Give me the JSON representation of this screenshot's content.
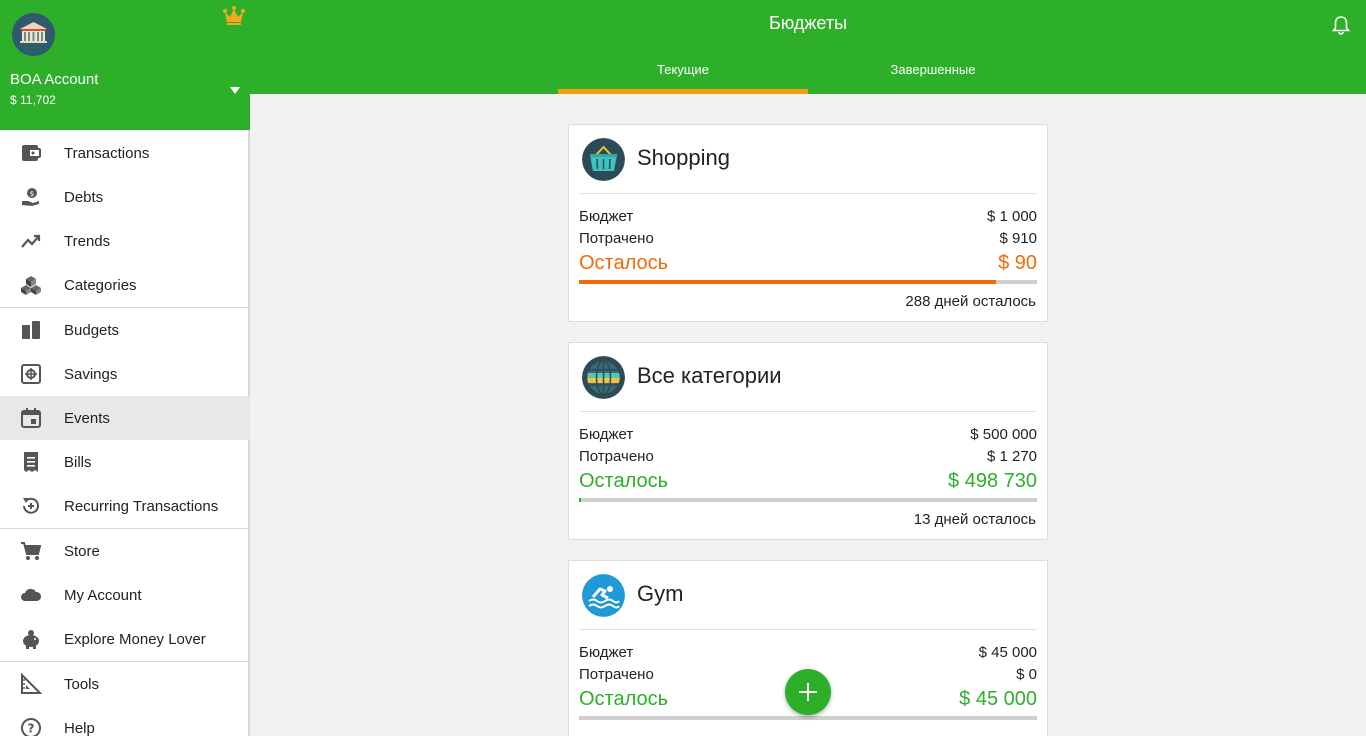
{
  "sidebar": {
    "wallet": {
      "name": "BOA Account",
      "balance": "$ 11,702"
    },
    "items": [
      {
        "label": "Transactions",
        "icon": "wallet-icon"
      },
      {
        "label": "Debts",
        "icon": "debt-icon"
      },
      {
        "label": "Trends",
        "icon": "trend-icon"
      },
      {
        "label": "Categories",
        "icon": "cubes-icon"
      },
      {
        "label": "Budgets",
        "icon": "budget-icon"
      },
      {
        "label": "Savings",
        "icon": "savings-icon"
      },
      {
        "label": "Events",
        "icon": "calendar-icon"
      },
      {
        "label": "Bills",
        "icon": "receipt-icon"
      },
      {
        "label": "Recurring Transactions",
        "icon": "recurring-icon"
      },
      {
        "label": "Store",
        "icon": "cart-icon"
      },
      {
        "label": "My Account",
        "icon": "cloud-icon"
      },
      {
        "label": "Explore Money Lover",
        "icon": "piggy-bank-icon"
      },
      {
        "label": "Tools",
        "icon": "ruler-icon"
      },
      {
        "label": "Help",
        "icon": "help-icon"
      }
    ]
  },
  "header": {
    "title": "Бюджеты",
    "tabs": [
      {
        "label": "Текущие"
      },
      {
        "label": "Завершенные"
      }
    ]
  },
  "colors": {
    "brand_green": "#2eaf2a",
    "tab_indicator": "#f39c12",
    "warning_orange": "#f26b0a"
  },
  "labels": {
    "budget": "Бюджет",
    "spent": "Потрачено",
    "left": "Осталось"
  },
  "budgets": [
    {
      "title": "Shopping",
      "icon": "shopping-basket-icon",
      "budget": "$ 1 000",
      "spent": "$ 910",
      "remaining": "$ 90",
      "progress": 0.91,
      "days_left": "288 дней осталось"
    },
    {
      "title": "Все категории",
      "icon": "globe-icon",
      "budget": "$ 500 000",
      "spent": "$ 1 270",
      "remaining": "$ 498 730",
      "progress": 0.003,
      "days_left": "13 дней осталось"
    },
    {
      "title": "Gym",
      "icon": "swimmer-icon",
      "budget": "$ 45 000",
      "spent": "$ 0",
      "remaining": "$ 45 000",
      "progress": 0
    }
  ]
}
